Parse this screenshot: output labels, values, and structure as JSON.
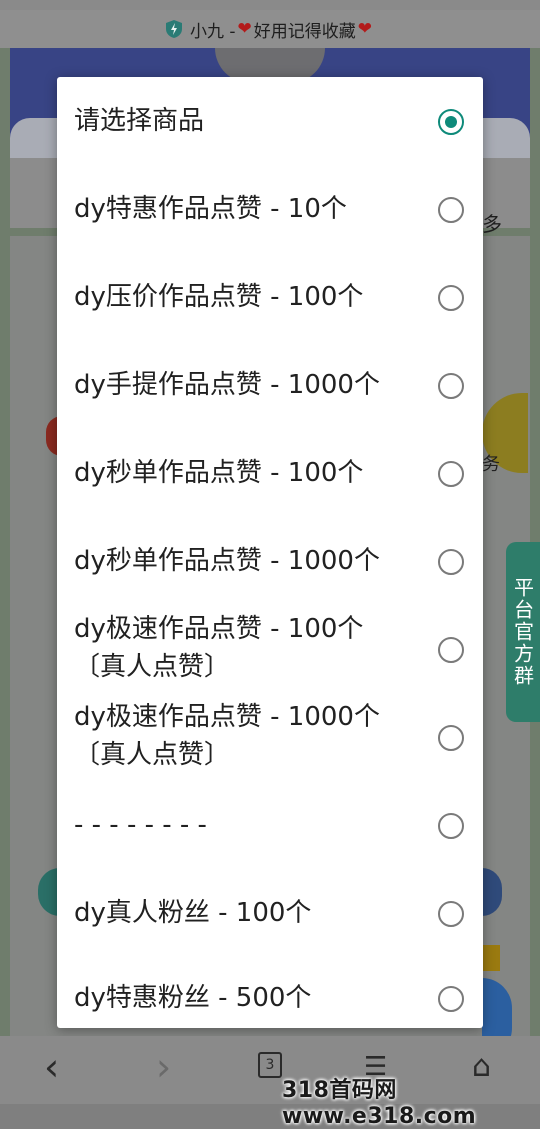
{
  "url_bar": {
    "title_prefix": "小九 - ",
    "title_main": "好用记得收藏",
    "heart": "❤"
  },
  "background": {
    "tab_more": "多",
    "side_tab": "平台官方群",
    "service_char": "务"
  },
  "modal": {
    "options": [
      {
        "line1": "请选择商品",
        "line2": "",
        "checked": true
      },
      {
        "line1": "dy特惠作品点赞 - 10个",
        "line2": "",
        "checked": false
      },
      {
        "line1": "dy压价作品点赞 - 100个",
        "line2": "",
        "checked": false
      },
      {
        "line1": "dy手提作品点赞 - 1000个",
        "line2": "",
        "checked": false
      },
      {
        "line1": "dy秒单作品点赞 - 100个",
        "line2": "",
        "checked": false
      },
      {
        "line1": "dy秒单作品点赞 - 1000个",
        "line2": "",
        "checked": false
      },
      {
        "line1": "dy极速作品点赞 - 100个",
        "line2": "〔真人点赞〕",
        "checked": false
      },
      {
        "line1": "dy极速作品点赞 - 1000个",
        "line2": "〔真人点赞〕",
        "checked": false
      },
      {
        "line1": "- - - - - - - -",
        "line2": "",
        "checked": false
      },
      {
        "line1": "dy真人粉丝 - 100个",
        "line2": "",
        "checked": false
      },
      {
        "line1": "dy特惠粉丝 - 500个",
        "line2": "",
        "checked": false
      }
    ]
  },
  "bottom_nav": {
    "back": "‹",
    "forward": "›",
    "tabs_count": "3",
    "menu": "☰",
    "home": "⌂"
  },
  "watermark": "318首码网 www.e318.com",
  "colors": {
    "accent": "#0e8a7a",
    "radio_border": "#7a7a7a"
  }
}
